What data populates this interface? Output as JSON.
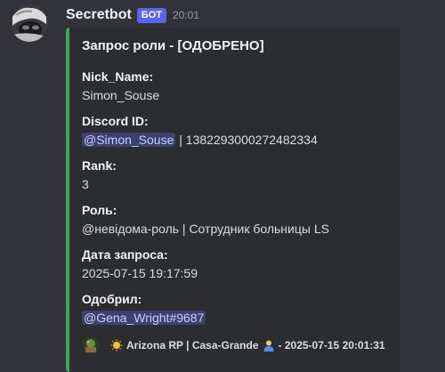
{
  "author": {
    "name": "Secretbot",
    "badge": "БОТ",
    "timestamp": "20:01",
    "avatar_icon": "masked-figure-avatar"
  },
  "embed": {
    "accent_color": "#3ba55d",
    "title": "Запрос роли - [ОДОБРЕНО]",
    "fields": [
      {
        "name": "Nick_Name:",
        "value": "Simon_Souse"
      },
      {
        "name": "Discord ID:",
        "mention": "@Simon_Souse",
        "value": " | 1382293000272482334"
      },
      {
        "name": "Rank:",
        "value": "3"
      },
      {
        "name": "Роль:",
        "value": "@невідома-роль | Сотрудник больницы LS"
      },
      {
        "name": "Дата запроса:",
        "value": "2025-07-15 19:17:59"
      },
      {
        "name": "Одобрил:",
        "mention": "@Gena_Wright#9687"
      }
    ],
    "footer": {
      "icon": "server-footer-icon",
      "emoji_before": "sun-emoji",
      "text": "Arizona RP | Casa-Grande",
      "emoji_after": "person-emoji",
      "timestamp": "- 2025-07-15 20:01:31"
    }
  }
}
